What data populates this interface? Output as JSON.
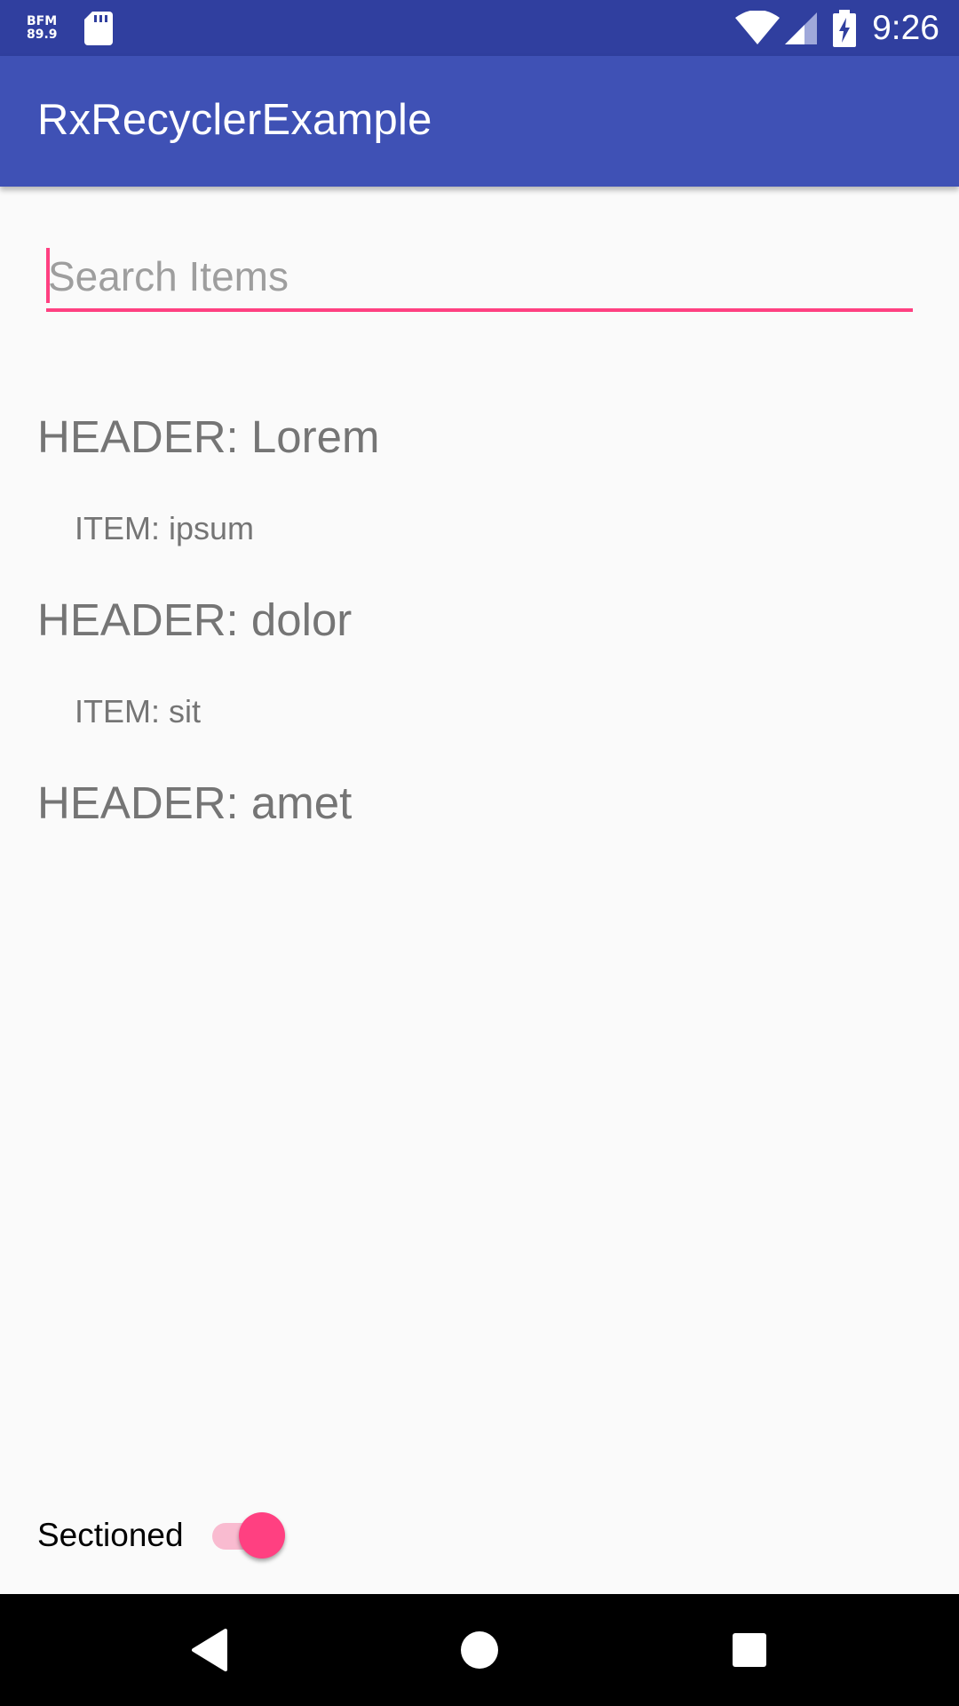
{
  "status_bar": {
    "radio_line1": "BFM",
    "radio_line2": "89.9",
    "time": "9:26",
    "icons": [
      "sd-card-icon",
      "wifi-icon",
      "cell-signal-icon",
      "battery-charging-icon"
    ]
  },
  "app_bar": {
    "title": "RxRecyclerExample"
  },
  "search": {
    "placeholder": "Search Items",
    "value": ""
  },
  "list": {
    "rows": [
      {
        "type": "header",
        "label": "HEADER: Lorem"
      },
      {
        "type": "item",
        "label": "ITEM: ipsum"
      },
      {
        "type": "header",
        "label": "HEADER: dolor"
      },
      {
        "type": "item",
        "label": "ITEM: sit"
      },
      {
        "type": "header",
        "label": "HEADER: amet"
      }
    ]
  },
  "toggle": {
    "label": "Sectioned",
    "checked": true
  },
  "nav_bar": {
    "icons": [
      "back-icon",
      "home-icon",
      "recents-icon"
    ]
  },
  "colors": {
    "status_bar": "#303f9f",
    "app_bar": "#3f51b5",
    "accent": "#ff4081",
    "background": "#fafafa",
    "list_text": "#757575"
  }
}
